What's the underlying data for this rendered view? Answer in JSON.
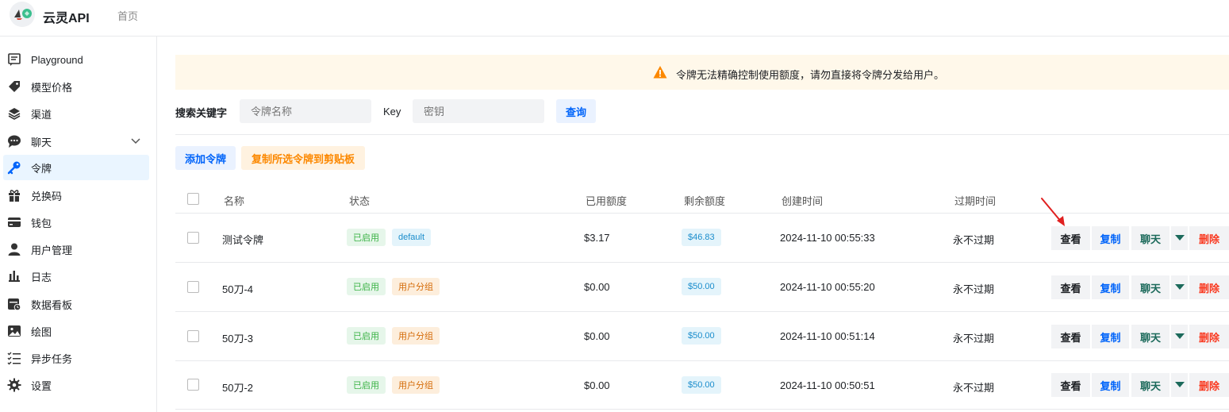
{
  "header": {
    "app_title": "云灵API",
    "nav_home": "首页"
  },
  "sidebar": {
    "items": [
      {
        "label": "Playground",
        "icon": "chat-square-icon"
      },
      {
        "label": "模型价格",
        "icon": "tag-icon"
      },
      {
        "label": "渠道",
        "icon": "layers-icon"
      },
      {
        "label": "聊天",
        "icon": "comment-icon"
      },
      {
        "label": "令牌",
        "icon": "key-icon"
      },
      {
        "label": "兑换码",
        "icon": "gift-icon"
      },
      {
        "label": "钱包",
        "icon": "credit-card-icon"
      },
      {
        "label": "用户管理",
        "icon": "user-icon"
      },
      {
        "label": "日志",
        "icon": "bar-chart-icon"
      },
      {
        "label": "数据看板",
        "icon": "calendar-clock-icon"
      },
      {
        "label": "绘图",
        "icon": "image-icon"
      },
      {
        "label": "异步任务",
        "icon": "task-list-icon"
      },
      {
        "label": "设置",
        "icon": "settings-icon"
      }
    ]
  },
  "banner": {
    "text": "令牌无法精确控制使用额度，请勿直接将令牌分发给用户。"
  },
  "search": {
    "label": "搜索关键字",
    "name_placeholder": "令牌名称",
    "key_label": "Key",
    "key_placeholder": "密钥",
    "query_button": "查询"
  },
  "toolbar": {
    "add_button": "添加令牌",
    "copy_selected_button": "复制所选令牌到剪贴板"
  },
  "table": {
    "headers": [
      "名称",
      "状态",
      "已用额度",
      "剩余额度",
      "创建时间",
      "过期时间"
    ],
    "rows": [
      {
        "name": "测试令牌",
        "status": "已启用",
        "group": "default",
        "used": "$3.17",
        "remaining": "$46.83",
        "created": "2024-11-10 00:55:33",
        "expires": "永不过期"
      },
      {
        "name": "50刀-4",
        "status": "已启用",
        "group": "用户分组",
        "used": "$0.00",
        "remaining": "$50.00",
        "created": "2024-11-10 00:55:20",
        "expires": "永不过期"
      },
      {
        "name": "50刀-3",
        "status": "已启用",
        "group": "用户分组",
        "used": "$0.00",
        "remaining": "$50.00",
        "created": "2024-11-10 00:51:14",
        "expires": "永不过期"
      },
      {
        "name": "50刀-2",
        "status": "已启用",
        "group": "用户分组",
        "used": "$0.00",
        "remaining": "$50.00",
        "created": "2024-11-10 00:50:51",
        "expires": "永不过期"
      }
    ],
    "actions": {
      "view": "查看",
      "copy": "复制",
      "chat": "聊天",
      "delete": "删除"
    }
  },
  "colors": {
    "accent": "#0064fa",
    "warning": "#fc8800",
    "danger": "#f93920",
    "annotation": "#e02020"
  }
}
